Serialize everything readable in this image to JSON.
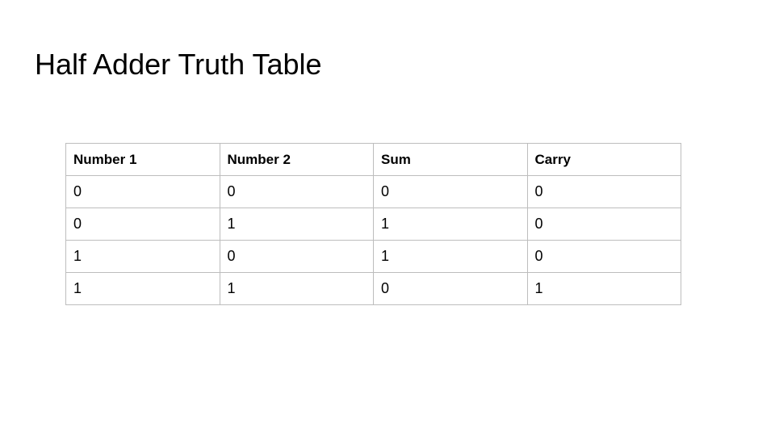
{
  "slide": {
    "title": "Half Adder Truth Table"
  },
  "table": {
    "headers": [
      "Number 1",
      "Number 2",
      "Sum",
      "Carry"
    ],
    "rows": [
      [
        "0",
        "0",
        "0",
        "0"
      ],
      [
        "0",
        "1",
        "1",
        "0"
      ],
      [
        "1",
        "0",
        "1",
        "0"
      ],
      [
        "1",
        "1",
        "0",
        "1"
      ]
    ]
  }
}
